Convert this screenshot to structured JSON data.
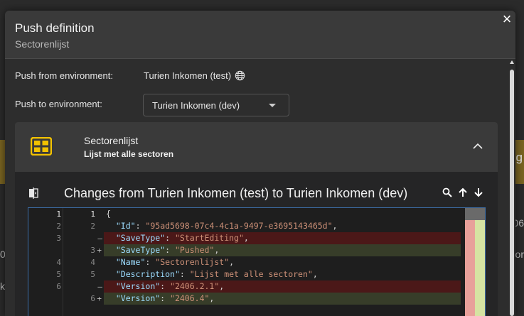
{
  "modal": {
    "title": "Push definition",
    "subtitle": "Sectorenlijst",
    "close_label": "×"
  },
  "push_from": {
    "label": "Push from environment:",
    "value": "Turien Inkomen (test)",
    "icon": "globe-icon"
  },
  "push_to": {
    "label": "Push to environment:",
    "selected": "Turien Inkomen (dev)"
  },
  "definition": {
    "title": "Sectorenlijst",
    "description": "Lijst met alle sectoren",
    "accent_color": "#f2c200"
  },
  "changes": {
    "title": "Changes from Turien Inkomen (test) to Turien Inkomen (dev)",
    "tools": [
      "search-icon",
      "arrow-up-icon",
      "arrow-down-icon"
    ]
  },
  "diff": {
    "left_line_numbers": [
      "1",
      "2",
      "3",
      "",
      "4",
      "5",
      "6",
      ""
    ],
    "right_line_numbers": [
      "1",
      "2",
      "",
      "3",
      "4",
      "5",
      "",
      "6"
    ],
    "right_markers": [
      "",
      "",
      "—",
      "+",
      "",
      "",
      "—",
      "+"
    ],
    "lines": [
      {
        "type": "context",
        "key": "",
        "value": "",
        "text": "{"
      },
      {
        "type": "context",
        "key": "\"Id\"",
        "value": "\"95ad5698-07c4-4c1a-9497-e3695143465d\""
      },
      {
        "type": "removed",
        "key": "\"SaveType\"",
        "value": "\"StartEditing\""
      },
      {
        "type": "added",
        "key": "\"SaveType\"",
        "value": "\"Pushed\""
      },
      {
        "type": "context",
        "key": "\"Name\"",
        "value": "\"Sectorenlijst\""
      },
      {
        "type": "context",
        "key": "\"Description\"",
        "value": "\"Lijst met alle sectoren\""
      },
      {
        "type": "removed",
        "key": "\"Version\"",
        "value": "\"2406.2.1\""
      },
      {
        "type": "added",
        "key": "\"Version\"",
        "value": "\"2406.4\""
      }
    ]
  }
}
